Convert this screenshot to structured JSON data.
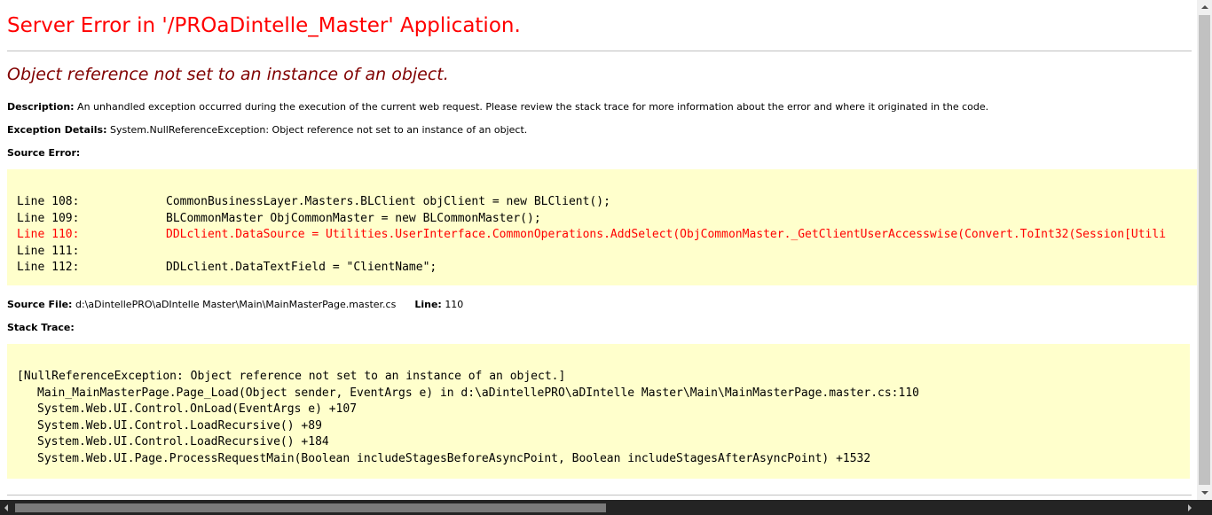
{
  "title": "Server Error in '/PROaDintelle_Master' Application.",
  "subtitle": "Object reference not set to an instance of an object.",
  "description": {
    "label": "Description:",
    "text": "An unhandled exception occurred during the execution of the current web request. Please review the stack trace for more information about the error and where it originated in the code."
  },
  "exception_details": {
    "label": "Exception Details:",
    "text": "System.NullReferenceException: Object reference not set to an instance of an object."
  },
  "source_error": {
    "label": "Source Error:",
    "lines": [
      {
        "num": "Line 108:",
        "code": "CommonBusinessLayer.Masters.BLClient objClient = new BLClient();"
      },
      {
        "num": "Line 109:",
        "code": "BLCommonMaster ObjCommonMaster = new BLCommonMaster();"
      },
      {
        "num": "Line 110:",
        "code": "DDLclient.DataSource = Utilities.UserInterface.CommonOperations.AddSelect(ObjCommonMaster._GetClientUserAccesswise(Convert.ToInt32(Session[Utili"
      },
      {
        "num": "Line 111:",
        "code": ""
      },
      {
        "num": "Line 112:",
        "code": "DDLclient.DataTextField = \"ClientName\";"
      }
    ],
    "highlight_color": "#ff0000"
  },
  "source_file": {
    "label": "Source File:",
    "path": "d:\\aDintellePRO\\aDIntelle Master\\Main\\MainMasterPage.master.cs",
    "line_label": "Line:",
    "line_value": "110"
  },
  "stack_trace": {
    "label": "Stack Trace:",
    "header": "[NullReferenceException: Object reference not set to an instance of an object.]",
    "frames": [
      "Main_MainMasterPage.Page_Load(Object sender, EventArgs e) in d:\\aDintellePRO\\aDIntelle Master\\Main\\MainMasterPage.master.cs:110",
      "System.Web.UI.Control.OnLoad(EventArgs e) +107",
      "System.Web.UI.Control.LoadRecursive() +89",
      "System.Web.UI.Control.LoadRecursive() +184",
      "System.Web.UI.Page.ProcessRequestMain(Boolean includeStagesBeforeAsyncPoint, Boolean includeStagesAfterAsyncPoint) +1532"
    ]
  },
  "colors": {
    "title": "#ff0000",
    "subtitle": "#800000",
    "code_background": "#ffffcc"
  },
  "icons": {
    "scroll_up": "arrow-up-icon",
    "scroll_down": "arrow-down-icon",
    "scroll_left": "arrow-left-icon",
    "scroll_right": "arrow-right-icon"
  }
}
